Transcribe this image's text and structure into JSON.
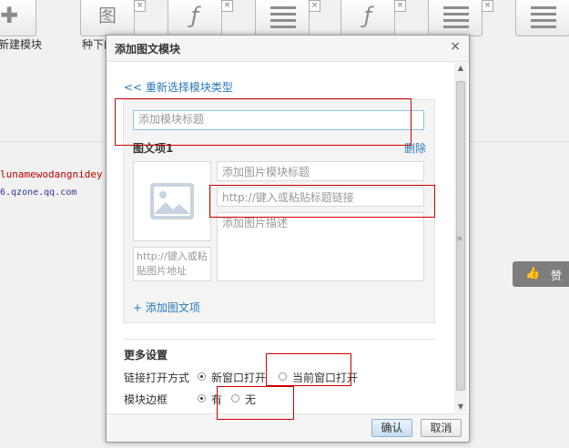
{
  "toolbar": {
    "new_module_label": "新建模块",
    "second_label": "种下的"
  },
  "background": {
    "red_text": "lunamewodangnidey",
    "url_text": "6.qzone.qq.com",
    "like_label": "赞"
  },
  "dialog": {
    "title": "添加图文模块",
    "close_glyph": "×",
    "back_link": "<< 重新选择模块类型",
    "module_title_placeholder": "添加模块标题",
    "item_label": "图文项1",
    "delete_label": "删除",
    "image_title_placeholder": "添加图片模块标题",
    "title_link_placeholder": "http://键入或粘贴标题链接",
    "image_desc_placeholder": "添加图片描述",
    "image_url_placeholder": "http://键入或粘贴图片地址",
    "add_item": "+ 添加图文项",
    "more_settings": "更多设置",
    "link_open_label": "链接打开方式",
    "link_options": [
      "新窗口打开",
      "当前窗口打开"
    ],
    "border_label": "模块边框",
    "border_options": [
      "有",
      "无"
    ],
    "confirm": "确认",
    "cancel": "取消"
  },
  "colors": {
    "link": "#2a7ab8",
    "annotation": "#d00000"
  }
}
